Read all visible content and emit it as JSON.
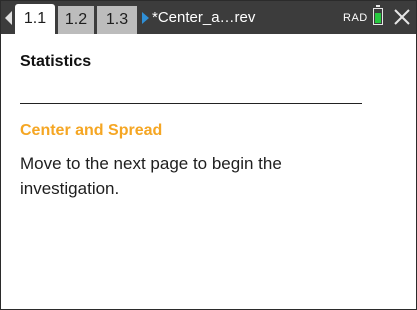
{
  "tabbar": {
    "tabs": [
      {
        "label": "1.1",
        "active": true
      },
      {
        "label": "1.2",
        "active": false
      },
      {
        "label": "1.3",
        "active": false
      }
    ],
    "document_title": "*Center_a…rev",
    "angle_mode": "RAD",
    "battery_level": 0.75,
    "icons": {
      "prev": "triangle-left-icon",
      "next": "triangle-right-icon",
      "battery": "battery-icon",
      "close": "close-icon"
    },
    "colors": {
      "bar": "#3c3c3c",
      "active_tab": "#ffffff",
      "inactive_tab": "#bcbcbc",
      "next_arrow": "#2f8fd6",
      "battery": "#27c93f"
    }
  },
  "page": {
    "heading": "Statistics",
    "section_heading": "Center and Spread",
    "body": "Move to the next page to begin the investigation.",
    "colors": {
      "section_heading": "#f5a623"
    }
  }
}
